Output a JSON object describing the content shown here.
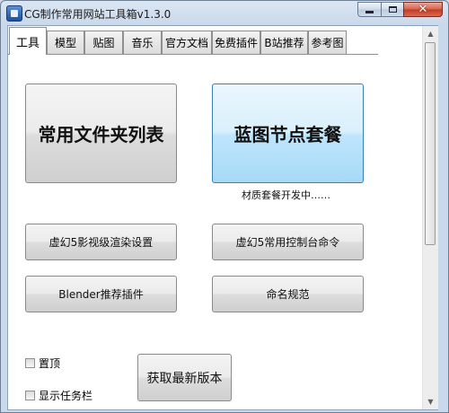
{
  "window": {
    "title": "CG制作常用网站工具箱v1.3.0"
  },
  "tabs": [
    {
      "label": "工具"
    },
    {
      "label": "模型"
    },
    {
      "label": "贴图"
    },
    {
      "label": "音乐"
    },
    {
      "label": "官方文档"
    },
    {
      "label": "免费插件"
    },
    {
      "label": "B站推荐"
    },
    {
      "label": "参考图"
    }
  ],
  "tools": {
    "folder_list": "常用文件夹列表",
    "blueprint_pack": "蓝图节点套餐",
    "material_note": "材质套餐开发中……",
    "ue5_render": "虚幻5影视级渲染设置",
    "ue5_console": "虚幻5常用控制台命令",
    "blender_plugins": "Blender推荐插件",
    "naming": "命名规范"
  },
  "options": {
    "pin_top": "置顶",
    "show_taskbar": "显示任务栏"
  },
  "update_button": "获取最新版本",
  "colors": {
    "accent_blue": "#bee6fd",
    "close_red": "#c23a22"
  }
}
